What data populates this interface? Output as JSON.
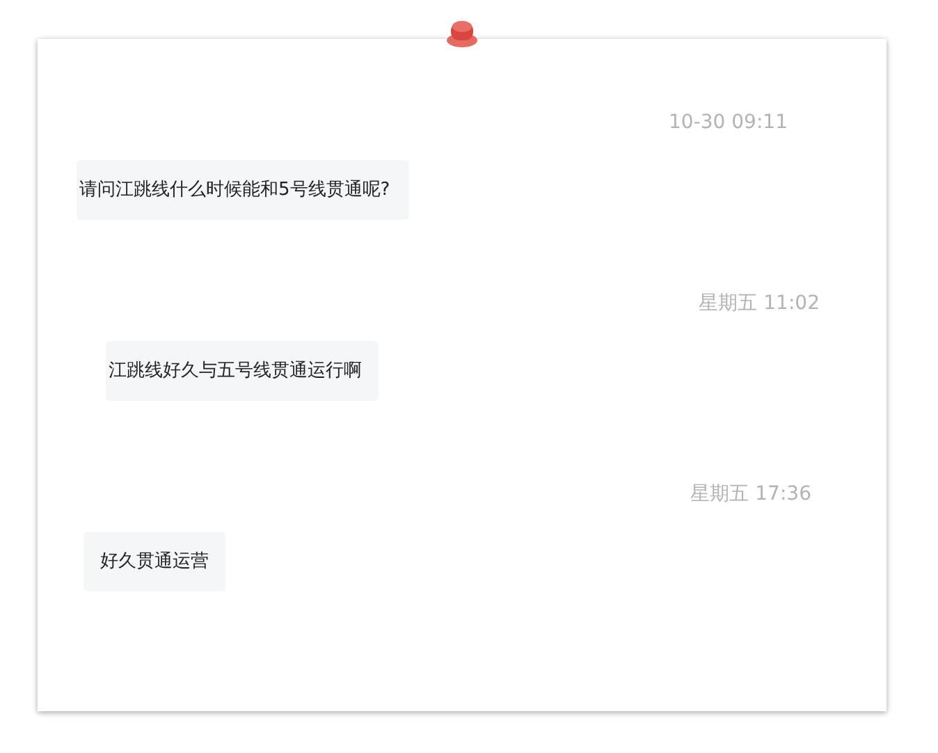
{
  "messages": [
    {
      "time": "10-30 09:11",
      "text": "请问江跳线什么时候能和5号线贯通呢?"
    },
    {
      "time": "星期五 11:02",
      "text": "江跳线好久与五号线贯通运行啊"
    },
    {
      "time": "星期五 17:36",
      "text": "好久贯通运营"
    }
  ]
}
